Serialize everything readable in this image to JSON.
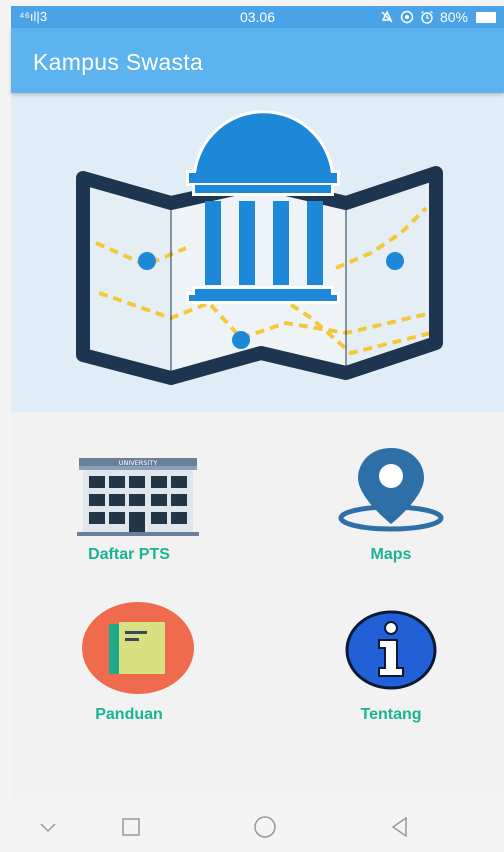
{
  "status_bar": {
    "signal": "⁴⁶ıl|3",
    "time": "03.06",
    "battery_percent": "80%",
    "icons": [
      "mute-icon",
      "data-saver-icon",
      "alarm-icon",
      "battery-icon"
    ]
  },
  "app_bar": {
    "title": "Kampus Swasta"
  },
  "hero": {
    "illustration": "campus-map-illustration",
    "building_sign": "UNIVERSITY"
  },
  "menu": {
    "items": [
      {
        "label": "Daftar PTS",
        "icon": "university-building-icon"
      },
      {
        "label": "Maps",
        "icon": "map-pin-icon"
      },
      {
        "label": "Panduan",
        "icon": "book-icon"
      },
      {
        "label": "Tentang",
        "icon": "info-icon"
      }
    ]
  },
  "nav_bar": {
    "icons": [
      "chevron-down-icon",
      "recents-square-icon",
      "home-circle-icon",
      "back-triangle-icon"
    ]
  },
  "colors": {
    "status_bar": "#4aa3e6",
    "app_bar": "#5db3ee",
    "hero_bg": "#e1edf6",
    "accent_label": "#1ab394",
    "icon_blue": "#1e88d8",
    "map_dark": "#1e3550"
  }
}
